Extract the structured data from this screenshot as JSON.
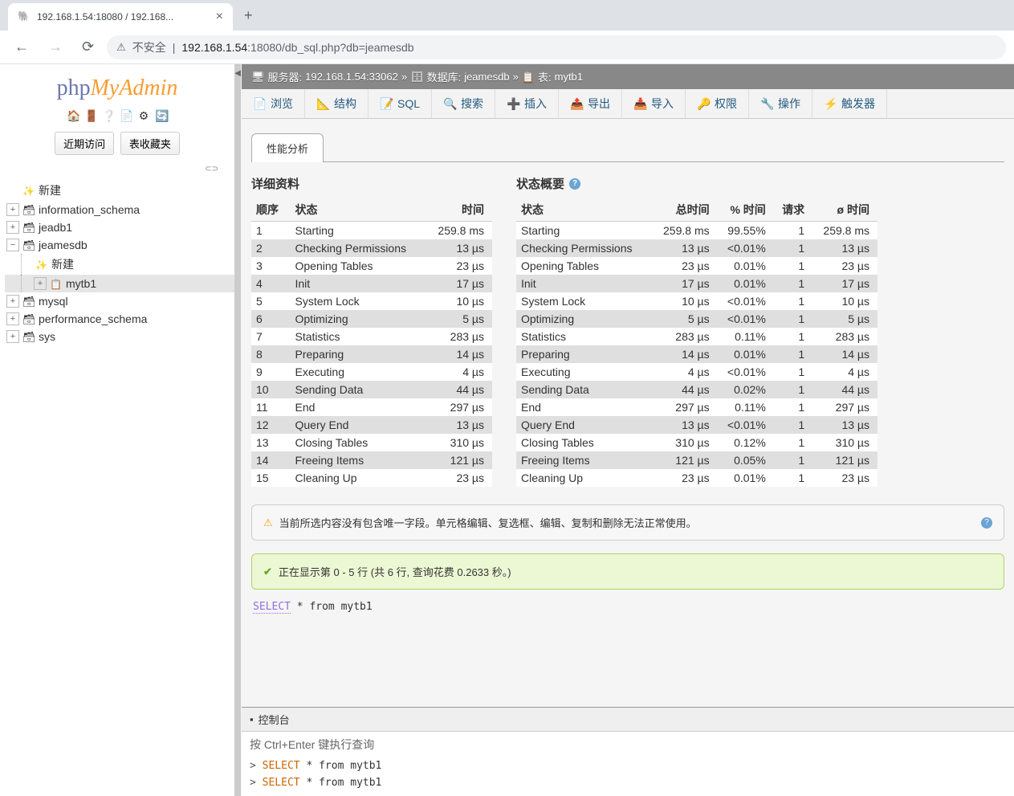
{
  "browser": {
    "tab_title": "192.168.1.54:18080 / 192.168...",
    "insecure": "不安全",
    "url_prefix": "192.168.1.54",
    "url_rest": ":18080/db_sql.php?db=jeamesdb"
  },
  "sidebar": {
    "logo_php": "php",
    "logo_my": "My",
    "logo_admin": "Admin",
    "recent": "近期访问",
    "favorites": "表收藏夹",
    "new": "新建",
    "dbs": [
      "information_schema",
      "jeadb1",
      "jeamesdb",
      "mysql",
      "performance_schema",
      "sys"
    ],
    "child_new": "新建",
    "child_table": "mytb1"
  },
  "breadcrumb": {
    "server_label": "服务器:",
    "server": "192.168.1.54:33062",
    "db_label": "数据库:",
    "db": "jeamesdb",
    "table_label": "表:",
    "table": "mytb1"
  },
  "tabs": [
    "浏览",
    "结构",
    "SQL",
    "搜索",
    "插入",
    "导出",
    "导入",
    "权限",
    "操作",
    "触发器"
  ],
  "perf_tab": "性能分析",
  "detail": {
    "title": "详细资料",
    "headers": [
      "顺序",
      "状态",
      "时间"
    ],
    "rows": [
      [
        "1",
        "Starting",
        "259.8 ms"
      ],
      [
        "2",
        "Checking Permissions",
        "13 µs"
      ],
      [
        "3",
        "Opening Tables",
        "23 µs"
      ],
      [
        "4",
        "Init",
        "17 µs"
      ],
      [
        "5",
        "System Lock",
        "10 µs"
      ],
      [
        "6",
        "Optimizing",
        "5 µs"
      ],
      [
        "7",
        "Statistics",
        "283 µs"
      ],
      [
        "8",
        "Preparing",
        "14 µs"
      ],
      [
        "9",
        "Executing",
        "4 µs"
      ],
      [
        "10",
        "Sending Data",
        "44 µs"
      ],
      [
        "11",
        "End",
        "297 µs"
      ],
      [
        "12",
        "Query End",
        "13 µs"
      ],
      [
        "13",
        "Closing Tables",
        "310 µs"
      ],
      [
        "14",
        "Freeing Items",
        "121 µs"
      ],
      [
        "15",
        "Cleaning Up",
        "23 µs"
      ]
    ]
  },
  "summary": {
    "title": "状态概要",
    "headers": [
      "状态",
      "总时间",
      "% 时间",
      "请求",
      "ø 时间"
    ],
    "rows": [
      [
        "Starting",
        "259.8 ms",
        "99.55%",
        "1",
        "259.8 ms"
      ],
      [
        "Checking Permissions",
        "13 µs",
        "<0.01%",
        "1",
        "13 µs"
      ],
      [
        "Opening Tables",
        "23 µs",
        "0.01%",
        "1",
        "23 µs"
      ],
      [
        "Init",
        "17 µs",
        "0.01%",
        "1",
        "17 µs"
      ],
      [
        "System Lock",
        "10 µs",
        "<0.01%",
        "1",
        "10 µs"
      ],
      [
        "Optimizing",
        "5 µs",
        "<0.01%",
        "1",
        "5 µs"
      ],
      [
        "Statistics",
        "283 µs",
        "0.11%",
        "1",
        "283 µs"
      ],
      [
        "Preparing",
        "14 µs",
        "0.01%",
        "1",
        "14 µs"
      ],
      [
        "Executing",
        "4 µs",
        "<0.01%",
        "1",
        "4 µs"
      ],
      [
        "Sending Data",
        "44 µs",
        "0.02%",
        "1",
        "44 µs"
      ],
      [
        "End",
        "297 µs",
        "0.11%",
        "1",
        "297 µs"
      ],
      [
        "Query End",
        "13 µs",
        "<0.01%",
        "1",
        "13 µs"
      ],
      [
        "Closing Tables",
        "310 µs",
        "0.12%",
        "1",
        "310 µs"
      ],
      [
        "Freeing Items",
        "121 µs",
        "0.05%",
        "1",
        "121 µs"
      ],
      [
        "Cleaning Up",
        "23 µs",
        "0.01%",
        "1",
        "23 µs"
      ]
    ]
  },
  "notice": "当前所选内容没有包含唯一字段。单元格编辑、复选框、编辑、复制和删除无法正常使用。",
  "success": "正在显示第 0 - 5 行 (共 6 行, 查询花费 0.2633 秒。)",
  "sql": {
    "select": "SELECT",
    "rest": " * from mytb1"
  },
  "console": {
    "title": "控制台",
    "hint": "按 Ctrl+Enter 键执行查询",
    "history": [
      {
        "kw": "SELECT",
        "rest": " * from mytb1"
      },
      {
        "kw": "SELECT",
        "rest": " * from mytb1"
      }
    ]
  }
}
